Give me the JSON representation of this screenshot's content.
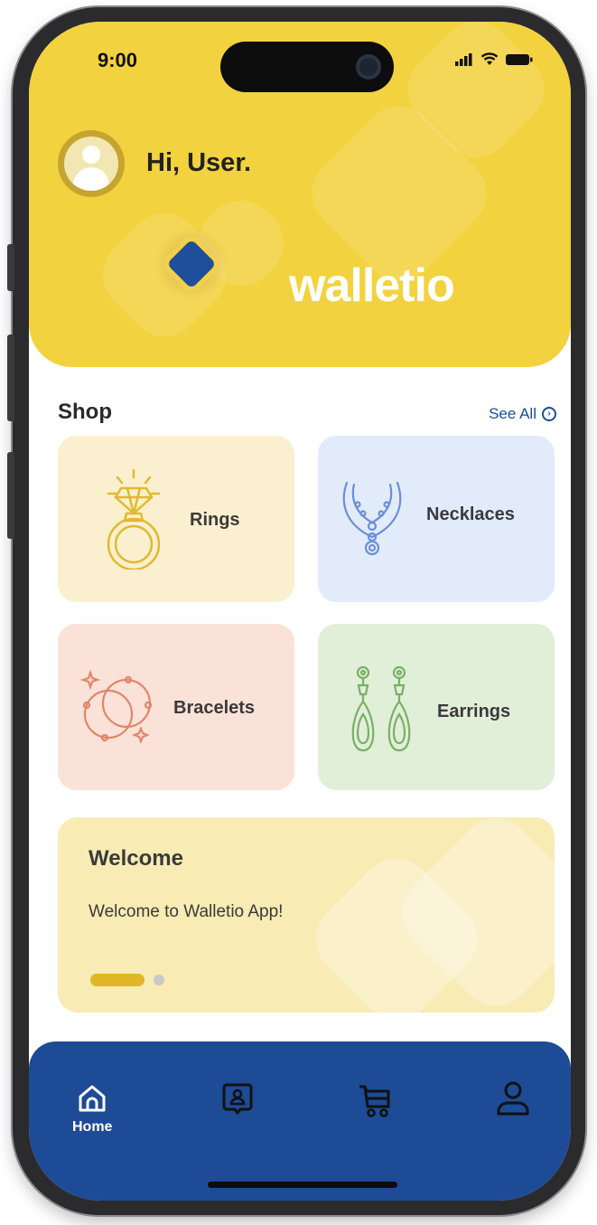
{
  "status_bar": {
    "time": "9:00"
  },
  "header": {
    "greeting": "Hi, User.",
    "brand": "walletio"
  },
  "shop": {
    "title": "Shop",
    "see_all": "See All",
    "categories": [
      {
        "label": "Rings",
        "bg": "#faf0cf",
        "icon": "ring-icon"
      },
      {
        "label": "Necklaces",
        "bg": "#e2ebfa",
        "icon": "necklace-icon"
      },
      {
        "label": "Bracelets",
        "bg": "#fbe2d8",
        "icon": "bracelets-icon"
      },
      {
        "label": "Earrings",
        "bg": "#e2efd8",
        "icon": "earrings-icon"
      }
    ]
  },
  "banner": {
    "title": "Welcome",
    "text": "Welcome to Walletio App!",
    "slide_count": 2,
    "active_slide": 1
  },
  "nav": {
    "items": [
      {
        "label": "Home",
        "icon": "home-icon",
        "active": true
      },
      {
        "label": "",
        "icon": "wallet-user-icon",
        "active": false
      },
      {
        "label": "",
        "icon": "cart-icon",
        "active": false
      },
      {
        "label": "",
        "icon": "profile-icon",
        "active": false
      }
    ]
  },
  "colors": {
    "header": "#f3d23f",
    "nav": "#1d4b96",
    "link": "#1d4b96",
    "indicator_active": "#e1b726"
  }
}
